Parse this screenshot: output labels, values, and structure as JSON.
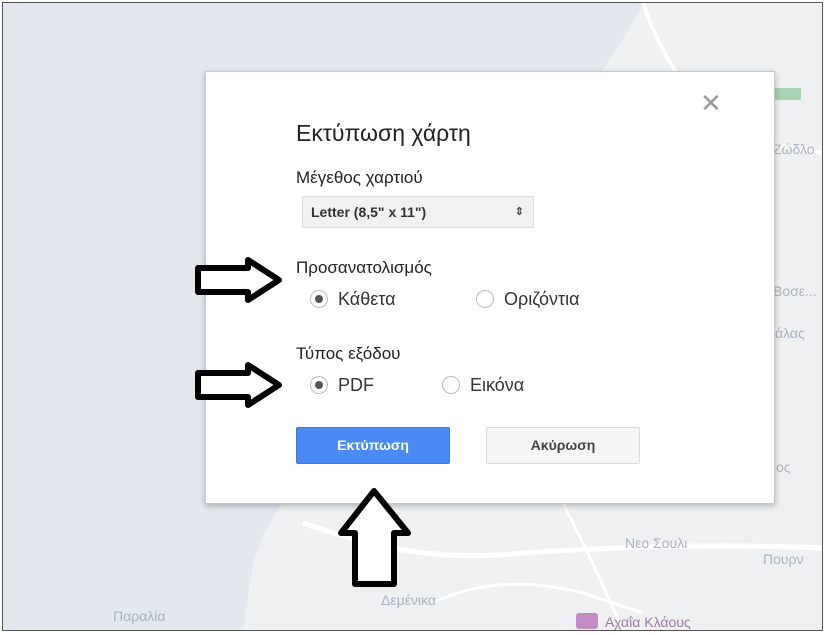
{
  "map": {
    "labels": [
      {
        "text": "Ζώδλο"
      },
      {
        "text": "Βοσε..."
      },
      {
        "text": "άλας"
      },
      {
        "text": "ος"
      },
      {
        "text": "Νεο Σουλι"
      },
      {
        "text": "Πουρν"
      },
      {
        "text": "Παραλία"
      },
      {
        "text": "Δεμένικα"
      },
      {
        "text": "Αχαΐα Κλάους"
      }
    ]
  },
  "dialog": {
    "close_icon": "close-icon",
    "title": "Εκτύπωση χάρτη",
    "paper_size": {
      "label": "Μέγεθος χαρτιού",
      "selected": "Letter (8,5\" x 11\")"
    },
    "orientation": {
      "label": "Προσανατολισμός",
      "options": [
        {
          "label": "Κάθετα",
          "checked": true
        },
        {
          "label": "Οριζόντια",
          "checked": false
        }
      ]
    },
    "output_type": {
      "label": "Τύπος εξόδου",
      "options": [
        {
          "label": "PDF",
          "checked": true
        },
        {
          "label": "Εικόνα",
          "checked": false
        }
      ]
    },
    "print_button": "Εκτύπωση",
    "cancel_button": "Ακύρωση",
    "primary_color": "#4a8af4"
  },
  "annotations": {
    "arrows": [
      "right-arrow-icon",
      "right-arrow-icon",
      "up-arrow-icon"
    ]
  }
}
